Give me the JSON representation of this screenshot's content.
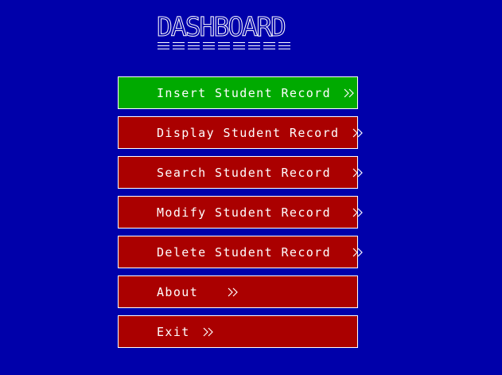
{
  "title": "DASHBOARD",
  "colors": {
    "background": "#0000AA",
    "button": "#AA0000",
    "button_active": "#00AA00",
    "text": "#FFFFFF"
  },
  "menu": {
    "items": [
      {
        "label": "Insert Student Record",
        "icon": "double-chevron-right-icon",
        "active": true
      },
      {
        "label": "Display Student Record",
        "icon": "double-chevron-right-icon",
        "active": false
      },
      {
        "label": "Search Student Record",
        "icon": "double-chevron-right-icon",
        "active": false
      },
      {
        "label": "Modify Student Record",
        "icon": "double-chevron-right-icon",
        "active": false
      },
      {
        "label": "Delete Student Record",
        "icon": "double-chevron-right-icon",
        "active": false
      },
      {
        "label": "About",
        "icon": "double-chevron-right-icon",
        "active": false
      },
      {
        "label": "Exit",
        "icon": "double-chevron-right-icon",
        "active": false
      }
    ]
  }
}
